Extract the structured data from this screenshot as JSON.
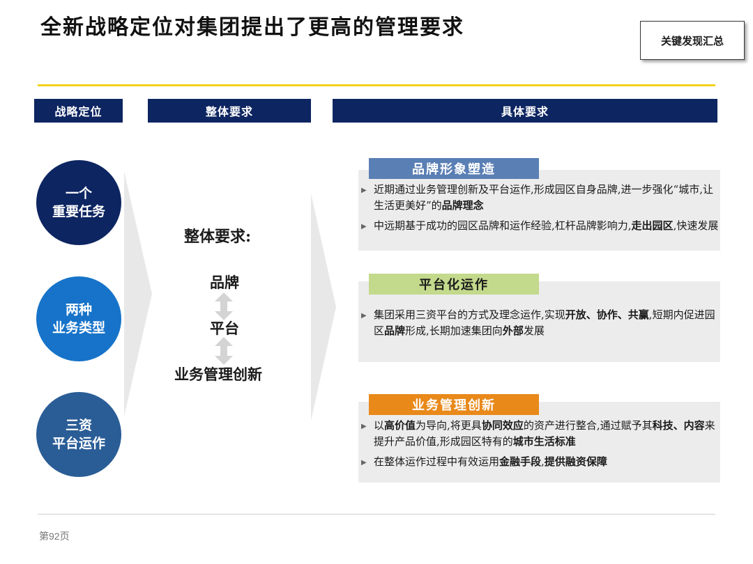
{
  "header": {
    "title": "全新战略定位对集团提出了更高的管理要求",
    "findings_label": "关键发现汇总"
  },
  "columns": {
    "col1": "战略定位",
    "col2": "整体要求",
    "col3": "具体要求"
  },
  "positions": [
    {
      "line1": "一个",
      "line2": "重要任务",
      "color": "#0d2561"
    },
    {
      "line1": "两种",
      "line2": "业务类型",
      "color": "#1673c9"
    },
    {
      "line1": "三资",
      "line2": "平台运作",
      "color": "#2a5d96"
    }
  ],
  "overall": {
    "title": "整体要求:",
    "items": [
      "品牌",
      "平台",
      "业务管理创新"
    ]
  },
  "sections": [
    {
      "tag": "品牌形象塑造",
      "tag_color": "#5a7fb4",
      "bullets": [
        {
          "pre": "近期通过业务管理创新及平台运作,形成园区自身品牌,进一步强化“城市,让生活更美好”的",
          "bold": "品牌理念",
          "post": ""
        },
        {
          "pre": "中远期基于成功的园区品牌和运作经验,杠杆品牌影响力,",
          "bold": "走出园区",
          "post": ",快速发展"
        }
      ]
    },
    {
      "tag": "平台化运作",
      "tag_color": "#c3d98c",
      "bullets": [
        {
          "pre": "集团采用三资平台的方式及理念运作,实现",
          "bold": "开放、协作、共赢",
          "mid": ",短期内促进园区",
          "bold2": "品牌",
          "mid2": "形成,长期加速集团向",
          "bold3": "外部",
          "post": "发展"
        }
      ]
    },
    {
      "tag": "业务管理创新",
      "tag_color": "#e8891a",
      "bullets": [
        {
          "pre": "以",
          "bold": "高价值",
          "mid": "为导向,将更具",
          "bold2": "协同效应",
          "mid2": "的资产进行整合,通过赋予其",
          "bold3": "科技、内容",
          "mid3": "来提升产品价值,形成园区特有的",
          "bold4": "城市生活标准",
          "post": ""
        },
        {
          "pre": "在整体运作过程中有效运用",
          "bold": "金融手段",
          "mid": ",",
          "bold2": "提供融资保障",
          "post": ""
        }
      ]
    }
  ],
  "footer": {
    "page": "第92页"
  }
}
